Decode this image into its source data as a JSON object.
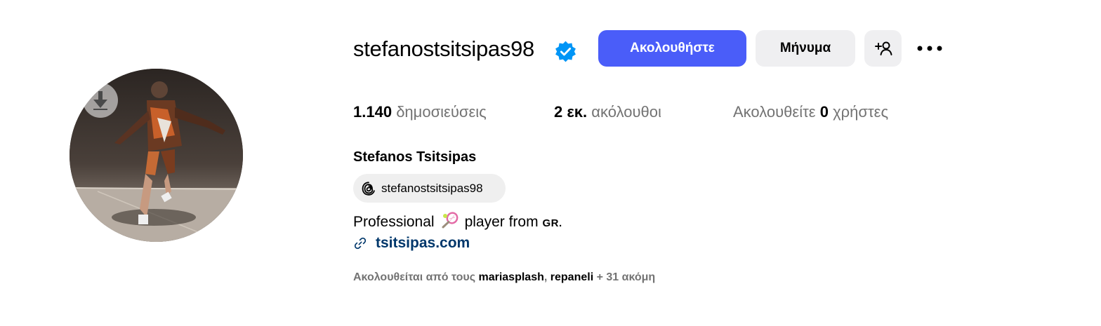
{
  "profile": {
    "username": "stefanostsitsipas98",
    "full_name": "Stefanos Tsitsipas",
    "verified_icon": "verified-badge-icon",
    "accent_color": "#4a5df9"
  },
  "actions": {
    "follow_label": "Ακολουθήστε",
    "message_label": "Μήνυμα"
  },
  "stats": {
    "posts_count": "1.140",
    "posts_label": "δημοσιεύσεις",
    "followers_count": "2 εκ.",
    "followers_label": "ακόλουθοι",
    "following_prefix": "Ακολουθείτε",
    "following_count": "0",
    "following_label": "χρήστες"
  },
  "threads": {
    "handle": "stefanostsitsipas98",
    "icon": "threads-icon"
  },
  "bio": {
    "text_before": "Professional",
    "emoji": "tennis-racket-icon",
    "text_after": "player from",
    "country": "GR."
  },
  "link": {
    "url_text": "tsitsipas.com"
  },
  "followed_by": {
    "prefix": "Ακολουθείται από τους",
    "user1": "mariasplash",
    "separator": ",",
    "user2": "repaneli",
    "suffix": "+ 31 ακόμη"
  }
}
